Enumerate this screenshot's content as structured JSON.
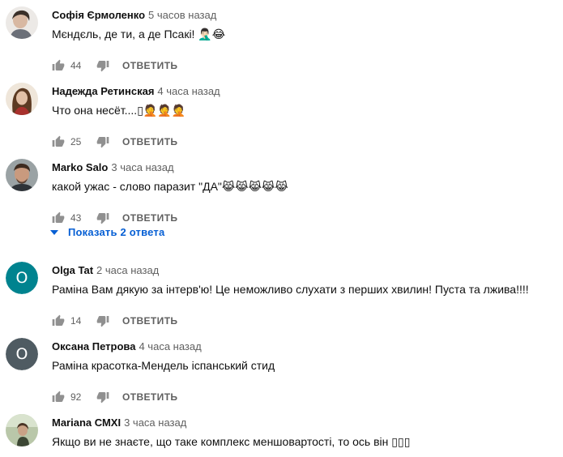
{
  "reply_label": "ОТВЕТИТЬ",
  "show_replies_label": "Показать 2 ответа",
  "colors": {
    "author": "#0f0f0f",
    "meta": "#606060",
    "link_blue": "#065fd4",
    "avatar_olga": "#00838f",
    "avatar_oksana": "#4f5b62"
  },
  "icons": {
    "like": "thumb-up-icon",
    "dislike": "thumb-down-icon",
    "expand": "caret-down-icon"
  },
  "comments": [
    {
      "author": "Софія Єрмоленко",
      "time": "5 часов назад",
      "text": "Мєндєль, де ти, а де Псакі!",
      "emoji": "🤦🏻‍♂️😂",
      "likes": "44"
    },
    {
      "author": "Надежда Ретинская",
      "time": "4 часа назад",
      "text": "Что она несёт....",
      "emoji": "▯🤦🤦🤦",
      "likes": "25"
    },
    {
      "author": "Marko Salo",
      "time": "3 часа назад",
      "text": "какой ужас - слово паразит \"ДА\"",
      "emoji": "😹😹😹😹😹",
      "likes": "43"
    },
    {
      "author": "Olga Tat",
      "time": "2 часа назад",
      "avatar_letter": "O",
      "text": "Раміна Вам дякую за інтерв'ю! Це неможливо слухати з перших хвилин! Пуста та лжива!!!!",
      "emoji": "",
      "likes": "14"
    },
    {
      "author": "Оксана Петрова",
      "time": "4 часа назад",
      "avatar_letter": "О",
      "text": "Раміна красотка-Мендель іспанський стид",
      "emoji": "",
      "likes": "92"
    },
    {
      "author": "Mariana СМХІ",
      "time": "3 часа назад",
      "text": "Якщо ви не знаєте, що таке комплекс меншовартості, то ось він",
      "emoji": "▯▯▯",
      "likes": ""
    }
  ]
}
